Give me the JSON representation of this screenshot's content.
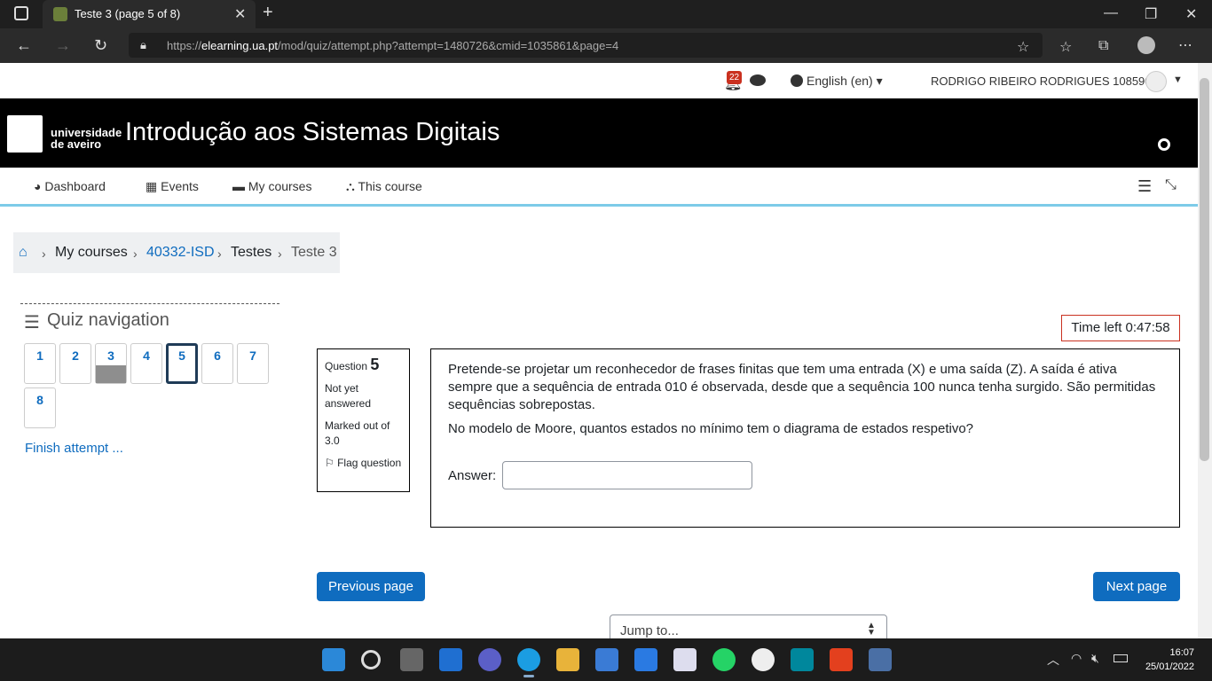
{
  "browser": {
    "tab_title": "Teste 3 (page 5 of 8)",
    "url_prefix": "https://",
    "url_domain": "elearning.ua.pt",
    "url_path": "/mod/quiz/attempt.php?attempt=1480726&cmid=1035861&page=4"
  },
  "topnav": {
    "notification_count": "22",
    "language": "English (en)",
    "user_name": "RODRIGO RIBEIRO RODRIGUES 108590"
  },
  "header": {
    "logo_line1": "universidade",
    "logo_line2": "de aveiro",
    "course_title": "Introdução aos Sistemas Digitais"
  },
  "nav": {
    "items": [
      {
        "label": "Dashboard"
      },
      {
        "label": "Events"
      },
      {
        "label": "My courses"
      },
      {
        "label": "This course"
      }
    ]
  },
  "breadcrumb": {
    "items": [
      "My courses",
      "40332-ISD",
      "Testes",
      "Teste 3"
    ]
  },
  "quiz_nav": {
    "title": "Quiz navigation",
    "buttons": [
      "1",
      "2",
      "3",
      "4",
      "5",
      "6",
      "7",
      "8"
    ],
    "finish": "Finish attempt ..."
  },
  "timer": {
    "label": "Time left 0:47:58"
  },
  "question": {
    "label": "Question",
    "number": "5",
    "status": "Not yet answered",
    "marked": "Marked out of 3.0",
    "flag": "Flag question",
    "text1": "Pretende-se projetar um reconhecedor de frases finitas que tem uma entrada (X) e uma saída (Z). A saída é ativa sempre que a sequência de entrada 010 é observada, desde que a sequência 100 nunca tenha surgido.  São permitidas sequências sobrepostas.",
    "text2": "No modelo de Moore, quantos estados no mínimo tem o diagrama de estados respetivo?",
    "answer_label": "Answer:",
    "answer_value": ""
  },
  "buttons": {
    "previous": "Previous page",
    "next": "Next page",
    "jump": "Jump to..."
  },
  "taskbar": {
    "time": "16:07",
    "date": "25/01/2022"
  }
}
